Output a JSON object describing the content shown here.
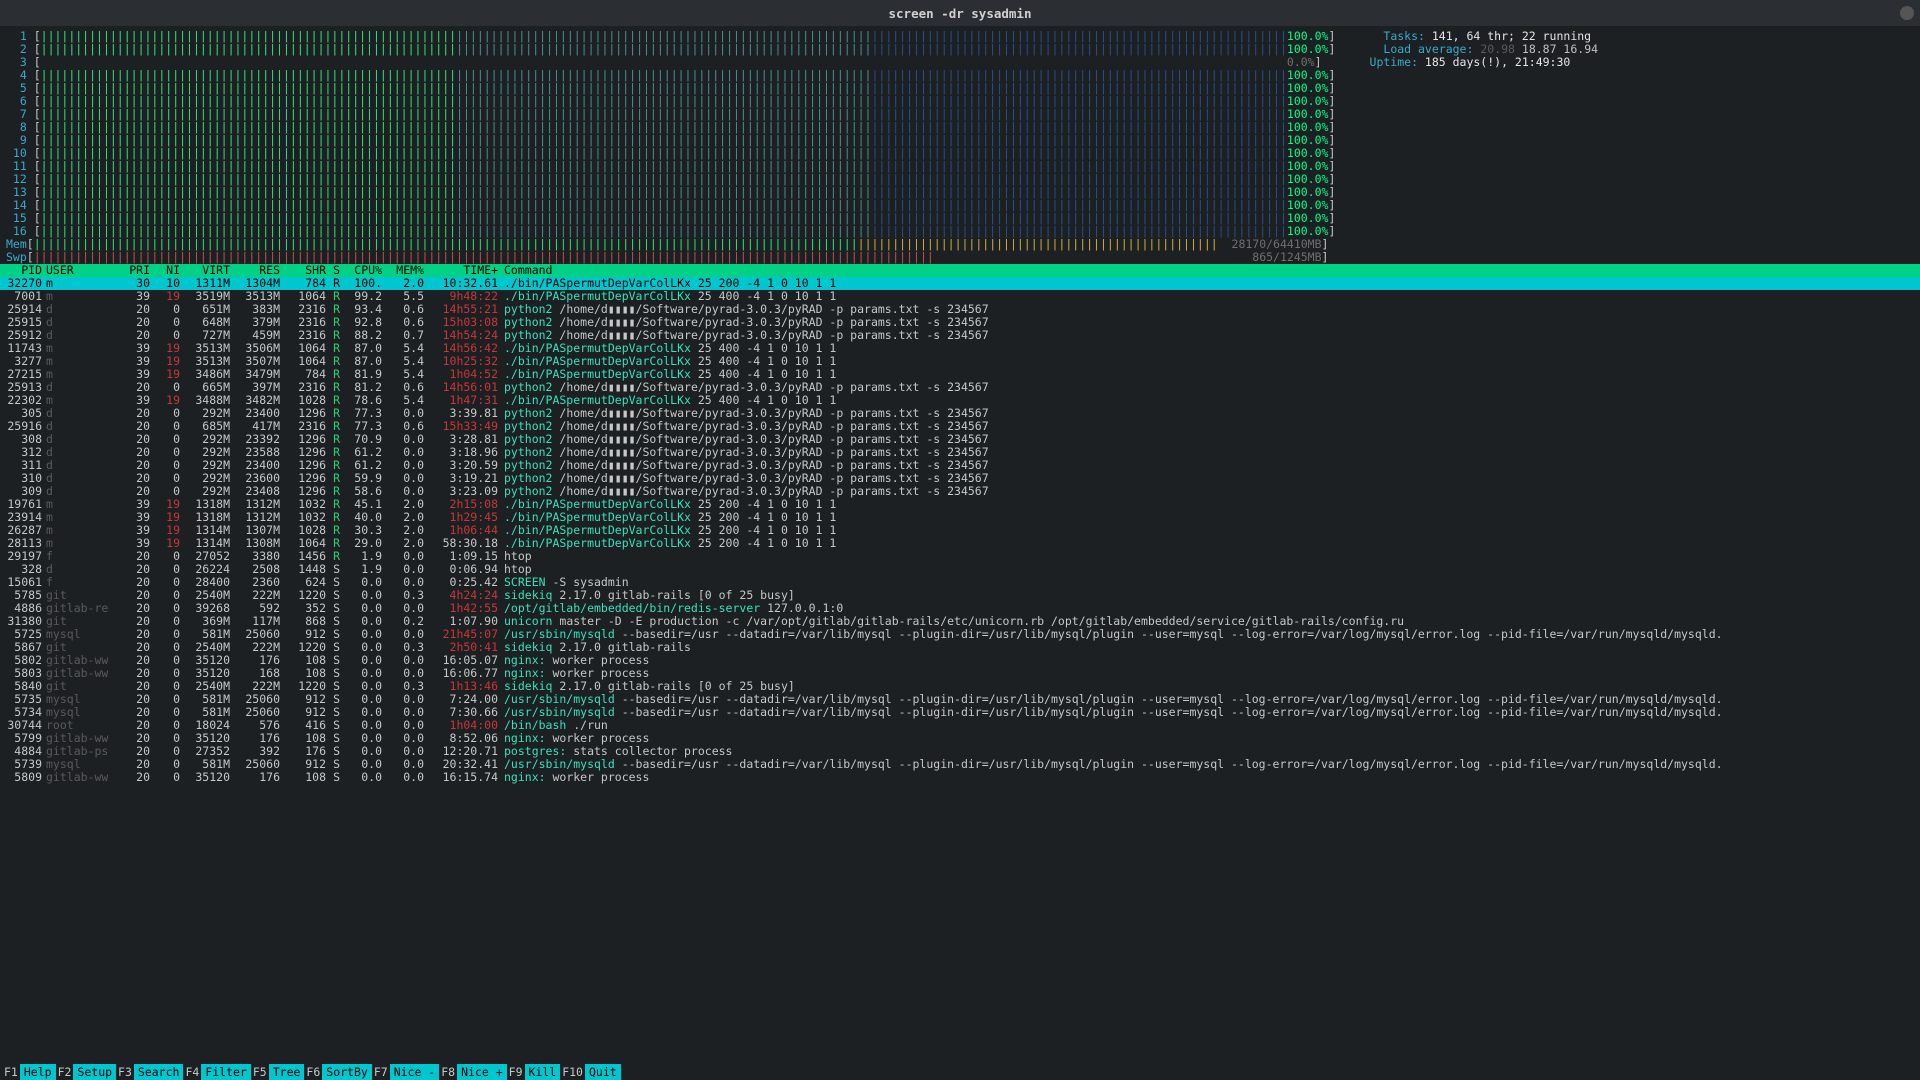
{
  "window_title": "screen -dr sysadmin",
  "cpus": [
    {
      "n": 1,
      "pct": "100.0%"
    },
    {
      "n": 2,
      "pct": "100.0%"
    },
    {
      "n": 3,
      "pct": "0.0%",
      "idle": true
    },
    {
      "n": 4,
      "pct": "100.0%"
    },
    {
      "n": 5,
      "pct": "100.0%"
    },
    {
      "n": 6,
      "pct": "100.0%"
    },
    {
      "n": 7,
      "pct": "100.0%"
    },
    {
      "n": 8,
      "pct": "100.0%"
    },
    {
      "n": 9,
      "pct": "100.0%"
    },
    {
      "n": 10,
      "pct": "100.0%"
    },
    {
      "n": 11,
      "pct": "100.0%"
    },
    {
      "n": 12,
      "pct": "100.0%"
    },
    {
      "n": 13,
      "pct": "100.0%"
    },
    {
      "n": 14,
      "pct": "100.0%"
    },
    {
      "n": 15,
      "pct": "100.0%"
    },
    {
      "n": 16,
      "pct": "100.0%"
    }
  ],
  "mem": {
    "label": "Mem",
    "text": "28170/64410MB"
  },
  "swp": {
    "label": "Swp",
    "text": "865/1245MB"
  },
  "sys": {
    "tasks_label": "Tasks: ",
    "tasks_value": "141, 64 thr; 22 running",
    "load_label": "Load average: ",
    "load_value": "20.98 18.87 16.94",
    "uptime_label": "Uptime: ",
    "uptime_value": "185 days(!), 21:49:30"
  },
  "columns": [
    "PID",
    "USER",
    "PRI",
    "NI",
    "VIRT",
    "RES",
    "SHR",
    "S",
    "CPU%",
    "MEM%",
    "TIME+",
    "Command"
  ],
  "procs": [
    {
      "sel": true,
      "pid": "32270",
      "user": "m",
      "pri": "30",
      "ni": "10",
      "virt": "1311M",
      "res": "1304M",
      "shr": "784",
      "s": "R",
      "cpu": "100.",
      "mem": "2.0",
      "time": "10:32.61",
      "nired": false,
      "timered": false,
      "cmd": "./bin/PASpermutDepVarColLKx 25 200 -4 1 0 10 1 1"
    },
    {
      "pid": "7001",
      "user": "m",
      "pri": "39",
      "ni": "19",
      "virt": "3519M",
      "res": "3513M",
      "shr": "1064",
      "s": "R",
      "cpu": "99.2",
      "mem": "5.5",
      "time": "9h48:22",
      "nired": true,
      "timered": true,
      "cmd": "./bin/PASpermutDepVarColLKx 25 400 -4 1 0 10 1 1"
    },
    {
      "pid": "25914",
      "user": "d",
      "pri": "20",
      "ni": "0",
      "virt": "651M",
      "res": "383M",
      "shr": "2316",
      "s": "R",
      "cpu": "93.4",
      "mem": "0.6",
      "time": "14h55:21",
      "nired": false,
      "timered": true,
      "cmd": "python2 /home/d▮▮▮▮/Software/pyrad-3.0.3/pyRAD -p params.txt -s 234567"
    },
    {
      "pid": "25915",
      "user": "d",
      "pri": "20",
      "ni": "0",
      "virt": "648M",
      "res": "379M",
      "shr": "2316",
      "s": "R",
      "cpu": "92.8",
      "mem": "0.6",
      "time": "15h03:08",
      "nired": false,
      "timered": true,
      "cmd": "python2 /home/d▮▮▮▮/Software/pyrad-3.0.3/pyRAD -p params.txt -s 234567"
    },
    {
      "pid": "25912",
      "user": "d",
      "pri": "20",
      "ni": "0",
      "virt": "727M",
      "res": "459M",
      "shr": "2316",
      "s": "R",
      "cpu": "88.2",
      "mem": "0.7",
      "time": "14h54:24",
      "nired": false,
      "timered": true,
      "cmd": "python2 /home/d▮▮▮▮/Software/pyrad-3.0.3/pyRAD -p params.txt -s 234567"
    },
    {
      "pid": "11743",
      "user": "m",
      "pri": "39",
      "ni": "19",
      "virt": "3513M",
      "res": "3506M",
      "shr": "1064",
      "s": "R",
      "cpu": "87.0",
      "mem": "5.4",
      "time": "14h56:42",
      "nired": true,
      "timered": true,
      "cmd": "./bin/PASpermutDepVarColLKx 25 400 -4 1 0 10 1 1"
    },
    {
      "pid": "3277",
      "user": "m",
      "pri": "39",
      "ni": "19",
      "virt": "3513M",
      "res": "3507M",
      "shr": "1064",
      "s": "R",
      "cpu": "87.0",
      "mem": "5.4",
      "time": "10h25:32",
      "nired": true,
      "timered": true,
      "cmd": "./bin/PASpermutDepVarColLKx 25 400 -4 1 0 10 1 1"
    },
    {
      "pid": "27215",
      "user": "m",
      "pri": "39",
      "ni": "19",
      "virt": "3486M",
      "res": "3479M",
      "shr": "784",
      "s": "R",
      "cpu": "81.9",
      "mem": "5.4",
      "time": "1h04:52",
      "nired": true,
      "timered": true,
      "cmd": "./bin/PASpermutDepVarColLKx 25 400 -4 1 0 10 1 1"
    },
    {
      "pid": "25913",
      "user": "d",
      "pri": "20",
      "ni": "0",
      "virt": "665M",
      "res": "397M",
      "shr": "2316",
      "s": "R",
      "cpu": "81.2",
      "mem": "0.6",
      "time": "14h56:01",
      "nired": false,
      "timered": true,
      "cmd": "python2 /home/d▮▮▮▮/Software/pyrad-3.0.3/pyRAD -p params.txt -s 234567"
    },
    {
      "pid": "22302",
      "user": "m",
      "pri": "39",
      "ni": "19",
      "virt": "3488M",
      "res": "3482M",
      "shr": "1028",
      "s": "R",
      "cpu": "78.6",
      "mem": "5.4",
      "time": "1h47:31",
      "nired": true,
      "timered": true,
      "cmd": "./bin/PASpermutDepVarColLKx 25 400 -4 1 0 10 1 1"
    },
    {
      "pid": "305",
      "user": "d",
      "pri": "20",
      "ni": "0",
      "virt": "292M",
      "res": "23400",
      "shr": "1296",
      "s": "R",
      "cpu": "77.3",
      "mem": "0.0",
      "time": "3:39.81",
      "nired": false,
      "timered": false,
      "cmd": "python2 /home/d▮▮▮▮/Software/pyrad-3.0.3/pyRAD -p params.txt -s 234567"
    },
    {
      "pid": "25916",
      "user": "d",
      "pri": "20",
      "ni": "0",
      "virt": "685M",
      "res": "417M",
      "shr": "2316",
      "s": "R",
      "cpu": "77.3",
      "mem": "0.6",
      "time": "15h33:49",
      "nired": false,
      "timered": true,
      "cmd": "python2 /home/d▮▮▮▮/Software/pyrad-3.0.3/pyRAD -p params.txt -s 234567"
    },
    {
      "pid": "308",
      "user": "d",
      "pri": "20",
      "ni": "0",
      "virt": "292M",
      "res": "23392",
      "shr": "1296",
      "s": "R",
      "cpu": "70.9",
      "mem": "0.0",
      "time": "3:28.81",
      "nired": false,
      "timered": false,
      "cmd": "python2 /home/d▮▮▮▮/Software/pyrad-3.0.3/pyRAD -p params.txt -s 234567"
    },
    {
      "pid": "312",
      "user": "d",
      "pri": "20",
      "ni": "0",
      "virt": "292M",
      "res": "23588",
      "shr": "1296",
      "s": "R",
      "cpu": "61.2",
      "mem": "0.0",
      "time": "3:18.96",
      "nired": false,
      "timered": false,
      "cmd": "python2 /home/d▮▮▮▮/Software/pyrad-3.0.3/pyRAD -p params.txt -s 234567"
    },
    {
      "pid": "311",
      "user": "d",
      "pri": "20",
      "ni": "0",
      "virt": "292M",
      "res": "23400",
      "shr": "1296",
      "s": "R",
      "cpu": "61.2",
      "mem": "0.0",
      "time": "3:20.59",
      "nired": false,
      "timered": false,
      "cmd": "python2 /home/d▮▮▮▮/Software/pyrad-3.0.3/pyRAD -p params.txt -s 234567"
    },
    {
      "pid": "310",
      "user": "d",
      "pri": "20",
      "ni": "0",
      "virt": "292M",
      "res": "23600",
      "shr": "1296",
      "s": "R",
      "cpu": "59.9",
      "mem": "0.0",
      "time": "3:19.21",
      "nired": false,
      "timered": false,
      "cmd": "python2 /home/d▮▮▮▮/Software/pyrad-3.0.3/pyRAD -p params.txt -s 234567"
    },
    {
      "pid": "309",
      "user": "d",
      "pri": "20",
      "ni": "0",
      "virt": "292M",
      "res": "23408",
      "shr": "1296",
      "s": "R",
      "cpu": "58.6",
      "mem": "0.0",
      "time": "3:23.09",
      "nired": false,
      "timered": false,
      "cmd": "python2 /home/d▮▮▮▮/Software/pyrad-3.0.3/pyRAD -p params.txt -s 234567"
    },
    {
      "pid": "19761",
      "user": "m",
      "pri": "39",
      "ni": "19",
      "virt": "1318M",
      "res": "1312M",
      "shr": "1032",
      "s": "R",
      "cpu": "45.1",
      "mem": "2.0",
      "time": "2h15:08",
      "nired": true,
      "timered": true,
      "cmd": "./bin/PASpermutDepVarColLKx 25 200 -4 1 0 10 1 1"
    },
    {
      "pid": "23914",
      "user": "m",
      "pri": "39",
      "ni": "19",
      "virt": "1318M",
      "res": "1312M",
      "shr": "1032",
      "s": "R",
      "cpu": "40.0",
      "mem": "2.0",
      "time": "1h29:45",
      "nired": true,
      "timered": true,
      "cmd": "./bin/PASpermutDepVarColLKx 25 200 -4 1 0 10 1 1"
    },
    {
      "pid": "26287",
      "user": "m",
      "pri": "39",
      "ni": "19",
      "virt": "1314M",
      "res": "1307M",
      "shr": "1028",
      "s": "R",
      "cpu": "30.3",
      "mem": "2.0",
      "time": "1h06:44",
      "nired": true,
      "timered": true,
      "cmd": "./bin/PASpermutDepVarColLKx 25 200 -4 1 0 10 1 1"
    },
    {
      "pid": "28113",
      "user": "m",
      "pri": "39",
      "ni": "19",
      "virt": "1314M",
      "res": "1308M",
      "shr": "1064",
      "s": "R",
      "cpu": "29.0",
      "mem": "2.0",
      "time": "58:30.18",
      "nired": true,
      "timered": false,
      "cmd": "./bin/PASpermutDepVarColLKx 25 200 -4 1 0 10 1 1"
    },
    {
      "pid": "29197",
      "user": "f",
      "pri": "20",
      "ni": "0",
      "virt": "27052",
      "res": "3380",
      "shr": "1456",
      "s": "R",
      "cpu": "1.9",
      "mem": "0.0",
      "time": "1:09.15",
      "nired": false,
      "timered": false,
      "cmd": "htop"
    },
    {
      "pid": "328",
      "user": "d",
      "pri": "20",
      "ni": "0",
      "virt": "26224",
      "res": "2508",
      "shr": "1448",
      "s": "S",
      "cpu": "1.9",
      "mem": "0.0",
      "time": "0:06.94",
      "nired": false,
      "timered": false,
      "cmd": "htop"
    },
    {
      "pid": "15061",
      "user": "f",
      "pri": "20",
      "ni": "0",
      "virt": "28400",
      "res": "2360",
      "shr": "624",
      "s": "S",
      "cpu": "0.0",
      "mem": "0.0",
      "time": "0:25.42",
      "nired": false,
      "timered": false,
      "cmd": "SCREEN -S sysadmin"
    },
    {
      "pid": "5785",
      "user": "git",
      "pri": "20",
      "ni": "0",
      "virt": "2540M",
      "res": "222M",
      "shr": "1220",
      "s": "S",
      "cpu": "0.0",
      "mem": "0.3",
      "time": "4h24:24",
      "nired": false,
      "timered": true,
      "cmd": "sidekiq 2.17.0 gitlab-rails [0 of 25 busy]"
    },
    {
      "pid": "4886",
      "user": "gitlab-re",
      "pri": "20",
      "ni": "0",
      "virt": "39268",
      "res": "592",
      "shr": "352",
      "s": "S",
      "cpu": "0.0",
      "mem": "0.0",
      "time": "1h42:55",
      "nired": false,
      "timered": true,
      "cmd": "/opt/gitlab/embedded/bin/redis-server 127.0.0.1:0"
    },
    {
      "pid": "31380",
      "user": "git",
      "pri": "20",
      "ni": "0",
      "virt": "369M",
      "res": "117M",
      "shr": "868",
      "s": "S",
      "cpu": "0.0",
      "mem": "0.2",
      "time": "1:07.90",
      "nired": false,
      "timered": false,
      "cmd": "unicorn master -D -E production -c /var/opt/gitlab/gitlab-rails/etc/unicorn.rb /opt/gitlab/embedded/service/gitlab-rails/config.ru"
    },
    {
      "pid": "5725",
      "user": "mysql",
      "pri": "20",
      "ni": "0",
      "virt": "581M",
      "res": "25060",
      "shr": "912",
      "s": "S",
      "cpu": "0.0",
      "mem": "0.0",
      "time": "21h45:07",
      "nired": false,
      "timered": true,
      "cmd": "/usr/sbin/mysqld --basedir=/usr --datadir=/var/lib/mysql --plugin-dir=/usr/lib/mysql/plugin --user=mysql --log-error=/var/log/mysql/error.log --pid-file=/var/run/mysqld/mysqld."
    },
    {
      "pid": "5867",
      "user": "git",
      "pri": "20",
      "ni": "0",
      "virt": "2540M",
      "res": "222M",
      "shr": "1220",
      "s": "S",
      "cpu": "0.0",
      "mem": "0.3",
      "time": "2h50:41",
      "nired": false,
      "timered": true,
      "cmd": "sidekiq 2.17.0 gitlab-rails"
    },
    {
      "pid": "5802",
      "user": "gitlab-ww",
      "pri": "20",
      "ni": "0",
      "virt": "35120",
      "res": "176",
      "shr": "108",
      "s": "S",
      "cpu": "0.0",
      "mem": "0.0",
      "time": "16:05.07",
      "nired": false,
      "timered": false,
      "cmd": "nginx: worker process"
    },
    {
      "pid": "5803",
      "user": "gitlab-ww",
      "pri": "20",
      "ni": "0",
      "virt": "35120",
      "res": "168",
      "shr": "108",
      "s": "S",
      "cpu": "0.0",
      "mem": "0.0",
      "time": "16:06.77",
      "nired": false,
      "timered": false,
      "cmd": "nginx: worker process"
    },
    {
      "pid": "5840",
      "user": "git",
      "pri": "20",
      "ni": "0",
      "virt": "2540M",
      "res": "222M",
      "shr": "1220",
      "s": "S",
      "cpu": "0.0",
      "mem": "0.3",
      "time": "1h13:46",
      "nired": false,
      "timered": true,
      "cmd": "sidekiq 2.17.0 gitlab-rails [0 of 25 busy]"
    },
    {
      "pid": "5735",
      "user": "mysql",
      "pri": "20",
      "ni": "0",
      "virt": "581M",
      "res": "25060",
      "shr": "912",
      "s": "S",
      "cpu": "0.0",
      "mem": "0.0",
      "time": "7:24.00",
      "nired": false,
      "timered": false,
      "cmd": "/usr/sbin/mysqld --basedir=/usr --datadir=/var/lib/mysql --plugin-dir=/usr/lib/mysql/plugin --user=mysql --log-error=/var/log/mysql/error.log --pid-file=/var/run/mysqld/mysqld."
    },
    {
      "pid": "5734",
      "user": "mysql",
      "pri": "20",
      "ni": "0",
      "virt": "581M",
      "res": "25060",
      "shr": "912",
      "s": "S",
      "cpu": "0.0",
      "mem": "0.0",
      "time": "7:30.66",
      "nired": false,
      "timered": false,
      "cmd": "/usr/sbin/mysqld --basedir=/usr --datadir=/var/lib/mysql --plugin-dir=/usr/lib/mysql/plugin --user=mysql --log-error=/var/log/mysql/error.log --pid-file=/var/run/mysqld/mysqld."
    },
    {
      "pid": "30744",
      "user": "root",
      "pri": "20",
      "ni": "0",
      "virt": "18024",
      "res": "576",
      "shr": "416",
      "s": "S",
      "cpu": "0.0",
      "mem": "0.0",
      "time": "1h04:00",
      "nired": false,
      "timered": true,
      "cmd": "/bin/bash ./run"
    },
    {
      "pid": "5799",
      "user": "gitlab-ww",
      "pri": "20",
      "ni": "0",
      "virt": "35120",
      "res": "176",
      "shr": "108",
      "s": "S",
      "cpu": "0.0",
      "mem": "0.0",
      "time": "8:52.06",
      "nired": false,
      "timered": false,
      "cmd": "nginx: worker process"
    },
    {
      "pid": "4884",
      "user": "gitlab-ps",
      "pri": "20",
      "ni": "0",
      "virt": "27352",
      "res": "392",
      "shr": "176",
      "s": "S",
      "cpu": "0.0",
      "mem": "0.0",
      "time": "12:20.71",
      "nired": false,
      "timered": false,
      "cmd": "postgres: stats collector process"
    },
    {
      "pid": "5739",
      "user": "mysql",
      "pri": "20",
      "ni": "0",
      "virt": "581M",
      "res": "25060",
      "shr": "912",
      "s": "S",
      "cpu": "0.0",
      "mem": "0.0",
      "time": "20:32.41",
      "nired": false,
      "timered": false,
      "cmd": "/usr/sbin/mysqld --basedir=/usr --datadir=/var/lib/mysql --plugin-dir=/usr/lib/mysql/plugin --user=mysql --log-error=/var/log/mysql/error.log --pid-file=/var/run/mysqld/mysqld."
    },
    {
      "pid": "5809",
      "user": "gitlab-ww",
      "pri": "20",
      "ni": "0",
      "virt": "35120",
      "res": "176",
      "shr": "108",
      "s": "S",
      "cpu": "0.0",
      "mem": "0.0",
      "time": "16:15.74",
      "nired": false,
      "timered": false,
      "cmd": "nginx: worker process"
    }
  ],
  "footer": [
    {
      "k": "F1",
      "v": "Help"
    },
    {
      "k": "F2",
      "v": "Setup"
    },
    {
      "k": "F3",
      "v": "Search"
    },
    {
      "k": "F4",
      "v": "Filter"
    },
    {
      "k": "F5",
      "v": "Tree"
    },
    {
      "k": "F6",
      "v": "SortBy"
    },
    {
      "k": "F7",
      "v": "Nice -"
    },
    {
      "k": "F8",
      "v": "Nice +"
    },
    {
      "k": "F9",
      "v": "Kill"
    },
    {
      "k": "F10",
      "v": "Quit"
    }
  ]
}
